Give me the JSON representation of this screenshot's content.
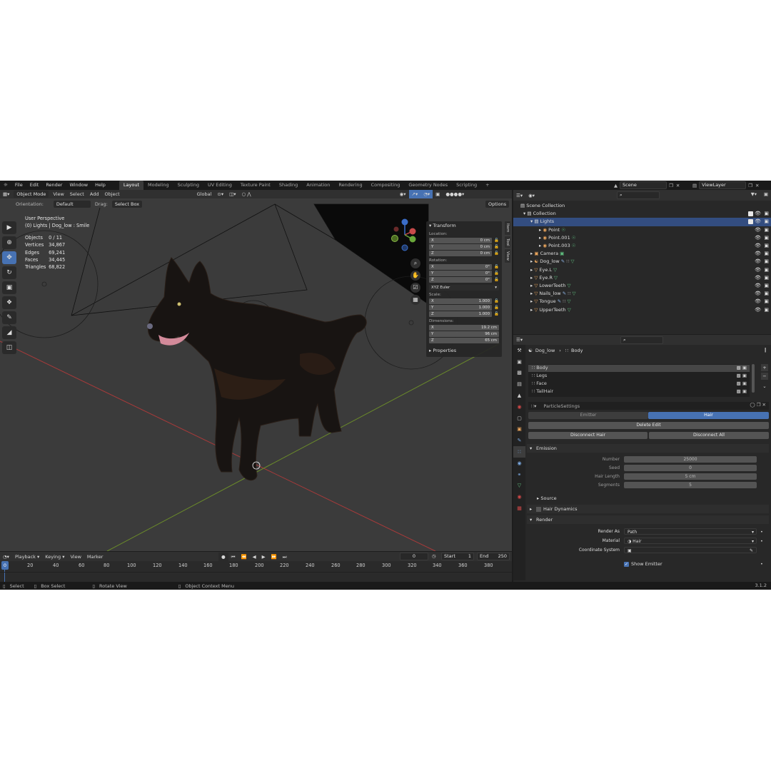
{
  "menubar": {
    "items": [
      "File",
      "Edit",
      "Render",
      "Window",
      "Help"
    ],
    "workspaces": [
      "Layout",
      "Modeling",
      "Sculpting",
      "UV Editing",
      "Texture Paint",
      "Shading",
      "Animation",
      "Rendering",
      "Compositing",
      "Geometry Nodes",
      "Scripting"
    ],
    "active_workspace": "Layout",
    "add_tab": "+",
    "scene": "Scene",
    "view_layer": "ViewLayer"
  },
  "viewport": {
    "mode": "Object Mode",
    "menus": [
      "View",
      "Select",
      "Add",
      "Object"
    ],
    "transform_orientation": "Global",
    "orientation_label": "Orientation:",
    "orientation_value": "Default",
    "drag_label": "Drag:",
    "drag_value": "Select Box",
    "options": "Options",
    "perspective": "User Perspective",
    "context": "(0) Lights | Dog_low : Smile",
    "stats": [
      {
        "label": "Objects",
        "value": "0 / 11"
      },
      {
        "label": "Vertices",
        "value": "34,867"
      },
      {
        "label": "Edges",
        "value": "69,241"
      },
      {
        "label": "Faces",
        "value": "34,445"
      },
      {
        "label": "Triangles",
        "value": "68,822"
      }
    ]
  },
  "npanel": {
    "title": "Transform",
    "location_label": "Location:",
    "location": [
      {
        "axis": "X",
        "value": "0 cm"
      },
      {
        "axis": "Y",
        "value": "0 cm"
      },
      {
        "axis": "Z",
        "value": "0 cm"
      }
    ],
    "rotation_label": "Rotation:",
    "rotation": [
      {
        "axis": "X",
        "value": "0°"
      },
      {
        "axis": "Y",
        "value": "0°"
      },
      {
        "axis": "Z",
        "value": "0°"
      }
    ],
    "rotation_mode": "XYZ Euler",
    "scale_label": "Scale:",
    "scale": [
      {
        "axis": "X",
        "value": "1.000"
      },
      {
        "axis": "Y",
        "value": "1.000"
      },
      {
        "axis": "Z",
        "value": "1.000"
      }
    ],
    "dimensions_label": "Dimensions:",
    "dimensions": [
      {
        "axis": "X",
        "value": "19.2 cm"
      },
      {
        "axis": "Y",
        "value": "96 cm"
      },
      {
        "axis": "Z",
        "value": "65 cm"
      }
    ],
    "properties": "Properties",
    "tabs": [
      "Item",
      "Tool",
      "View"
    ]
  },
  "timeline": {
    "menus": [
      "Playback",
      "Keying",
      "View",
      "Marker"
    ],
    "current_frame": "0",
    "start_label": "Start",
    "start": "1",
    "end_label": "End",
    "end": "250",
    "ruler": [
      "0",
      "20",
      "40",
      "60",
      "80",
      "100",
      "120",
      "140",
      "160",
      "180",
      "200",
      "220",
      "240",
      "260",
      "280",
      "300",
      "320",
      "340",
      "360",
      "380"
    ]
  },
  "statusbar": {
    "select": "Select",
    "box_select": "Box Select",
    "rotate_view": "Rotate View",
    "context_menu": "Object Context Menu",
    "version": "3.1.2"
  },
  "outliner": {
    "rows": [
      {
        "name": "Scene Collection",
        "depth": 0,
        "icon": "scene-collection-icon",
        "selected": false
      },
      {
        "name": "Collection",
        "depth": 1,
        "icon": "collection-icon",
        "selected": false
      },
      {
        "name": "Lights",
        "depth": 2,
        "icon": "collection-icon",
        "selected": true
      },
      {
        "name": "Point",
        "depth": 3,
        "icon": "light-icon",
        "selected": false
      },
      {
        "name": "Point.001",
        "depth": 3,
        "icon": "light-icon",
        "selected": false
      },
      {
        "name": "Point.003",
        "depth": 3,
        "icon": "light-icon",
        "selected": false
      },
      {
        "name": "Camera",
        "depth": 2,
        "icon": "camera-icon",
        "selected": false
      },
      {
        "name": "Dog_low",
        "depth": 2,
        "icon": "mesh-icon",
        "selected": false
      },
      {
        "name": "Eye.L",
        "depth": 2,
        "icon": "mesh-icon",
        "selected": false
      },
      {
        "name": "Eye.R",
        "depth": 2,
        "icon": "mesh-icon",
        "selected": false
      },
      {
        "name": "LowerTeeth",
        "depth": 2,
        "icon": "mesh-icon",
        "selected": false
      },
      {
        "name": "Nails_low",
        "depth": 2,
        "icon": "mesh-icon",
        "selected": false
      },
      {
        "name": "Tongue",
        "depth": 2,
        "icon": "mesh-icon",
        "selected": false
      },
      {
        "name": "UpperTeeth",
        "depth": 2,
        "icon": "mesh-icon",
        "selected": false
      }
    ]
  },
  "properties": {
    "breadcrumb_object": "Dog_low",
    "breadcrumb_item": "Body",
    "particle_systems": [
      "Body",
      "Legs",
      "Face",
      "TailHair"
    ],
    "active_system": "Body",
    "settings_name": "ParticleSettings",
    "type_emitter": "Emitter",
    "type_hair": "Hair",
    "active_type": "Hair",
    "delete_edit": "Delete Edit",
    "disconnect_hair": "Disconnect Hair",
    "disconnect_all": "Disconnect All",
    "emission": {
      "title": "Emission",
      "fields": [
        {
          "label": "Number",
          "value": "25000"
        },
        {
          "label": "Seed",
          "value": "0"
        },
        {
          "label": "Hair Length",
          "value": "5 cm"
        },
        {
          "label": "Segments",
          "value": "5"
        }
      ],
      "source": "Source"
    },
    "hair_dynamics": "Hair Dynamics",
    "render": {
      "title": "Render",
      "render_as_label": "Render As",
      "render_as": "Path",
      "material_label": "Material",
      "material": "Hair",
      "coordinate_system_label": "Coordinate System",
      "show_emitter": "Show Emitter"
    }
  },
  "colors": {
    "accent": "#4772b3",
    "selection": "#334d80",
    "grid_x": "#a83a3a",
    "grid_y": "#6a8a2a"
  }
}
